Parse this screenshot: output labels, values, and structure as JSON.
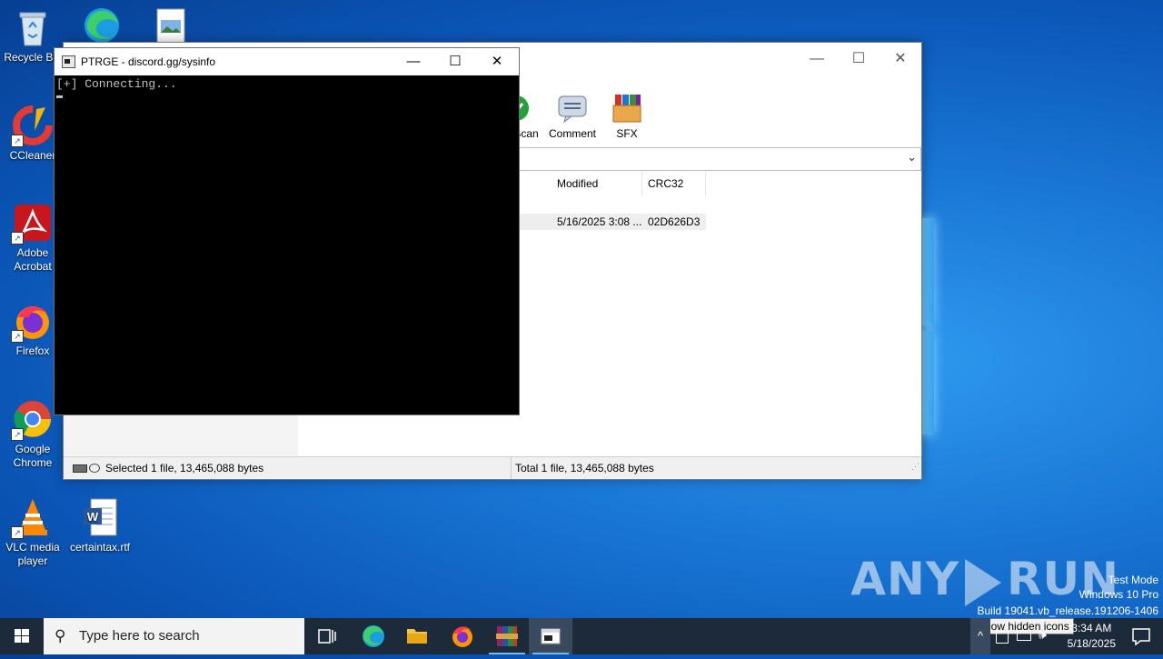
{
  "desktop": {
    "icons": [
      {
        "label": "Recycle Bin"
      },
      {
        "label": "CCleaner"
      },
      {
        "label": "Adobe Acrobat"
      },
      {
        "label": "Firefox"
      },
      {
        "label": "Google Chrome"
      },
      {
        "label": "VLC media player"
      },
      {
        "label": "certaintax.rtf"
      }
    ]
  },
  "winrar": {
    "toolbar": [
      {
        "label": "Scan",
        "icon": "scan-icon"
      },
      {
        "label": "Comment",
        "icon": "comment-icon"
      },
      {
        "label": "SFX",
        "icon": "sfx-icon"
      }
    ],
    "columns": {
      "modified": "Modified",
      "crc": "CRC32"
    },
    "row": {
      "modified": "5/16/2025 3:08 ...",
      "crc": "02D626D3"
    },
    "status": {
      "left": "Selected 1 file, 13,465,088 bytes",
      "right": "Total 1 file, 13,465,088 bytes"
    }
  },
  "console": {
    "title": "PTRGE - discord.gg/sysinfo",
    "line1": "[+] Connecting..."
  },
  "watermark": {
    "brand_left": "ANY",
    "brand_right": "RUN",
    "mode": "Test Mode",
    "edition": "Windows 10 Pro",
    "build": "Build 19041.vb_release.191206-1406"
  },
  "taskbar": {
    "search_placeholder": "Type here to search",
    "tooltip": "Show hidden icons",
    "time": "3:34 AM",
    "date": "5/18/2025"
  },
  "colors": {
    "accent": "#76b9ed",
    "taskbar": "#1d2a3a",
    "desktop": "#1a78d6"
  }
}
